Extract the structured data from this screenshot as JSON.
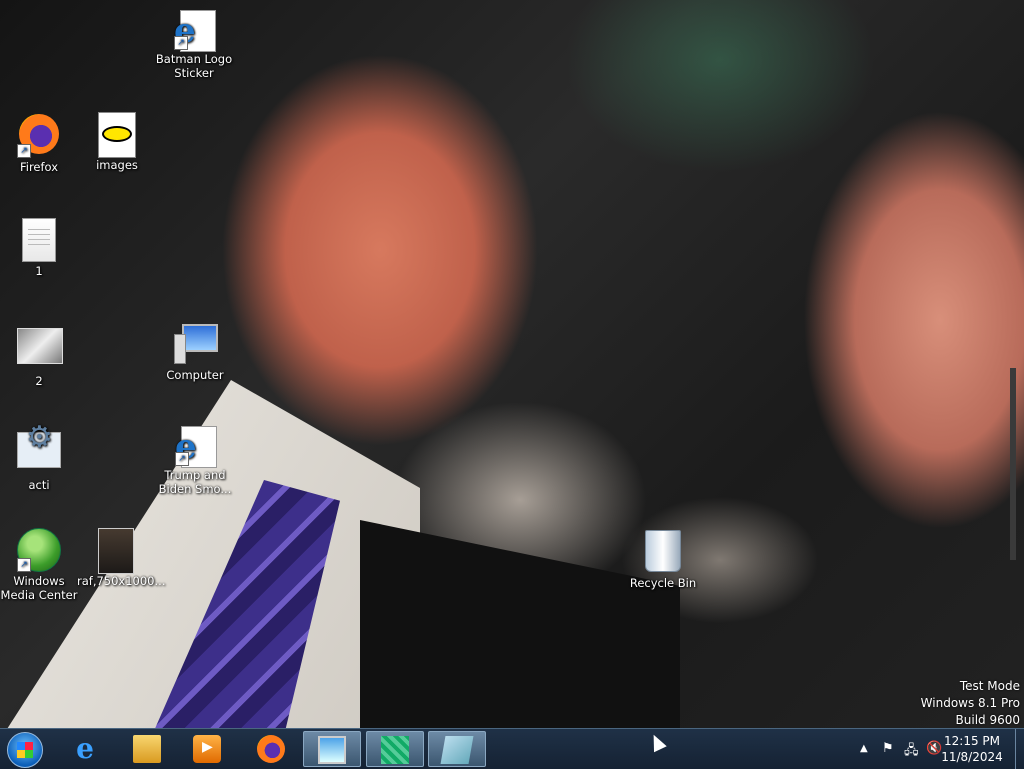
{
  "desktop": {
    "icons": [
      {
        "label": "Batman Logo Sticker",
        "icon": "internet-shortcut-icon"
      },
      {
        "label": "Firefox",
        "icon": "firefox-icon"
      },
      {
        "label": "images",
        "icon": "batman-image-icon"
      },
      {
        "label": "1",
        "icon": "text-file-icon"
      },
      {
        "label": "2",
        "icon": "image-file-icon"
      },
      {
        "label": "Computer",
        "icon": "computer-icon"
      },
      {
        "label": "acti",
        "icon": "settings-file-icon"
      },
      {
        "label": "Trump and Biden Smo...",
        "icon": "internet-shortcut-icon"
      },
      {
        "label": "Windows Media Center",
        "icon": "windows-media-center-icon"
      },
      {
        "label": "raf,750x1000...",
        "icon": "image-file-icon"
      },
      {
        "label": "Recycle Bin",
        "icon": "recycle-bin-icon"
      }
    ],
    "watermark": {
      "line1": "Test Mode",
      "line2": "Windows 8.1 Pro",
      "line3": "Build 9600"
    }
  },
  "taskbar": {
    "start_label": "Start",
    "pinned": [
      {
        "name": "Internet Explorer",
        "icon": "internet-explorer-icon"
      },
      {
        "name": "File Explorer",
        "icon": "folder-icon"
      },
      {
        "name": "Windows Media Player",
        "icon": "media-player-icon"
      },
      {
        "name": "Firefox",
        "icon": "firefox-icon"
      },
      {
        "name": "Photo Viewer",
        "icon": "image-viewer-icon"
      },
      {
        "name": "Application",
        "icon": "cube-app-icon"
      },
      {
        "name": "Tool",
        "icon": "tool-app-icon"
      }
    ],
    "tray": {
      "time": "12:15 PM",
      "date": "11/8/2024"
    }
  }
}
